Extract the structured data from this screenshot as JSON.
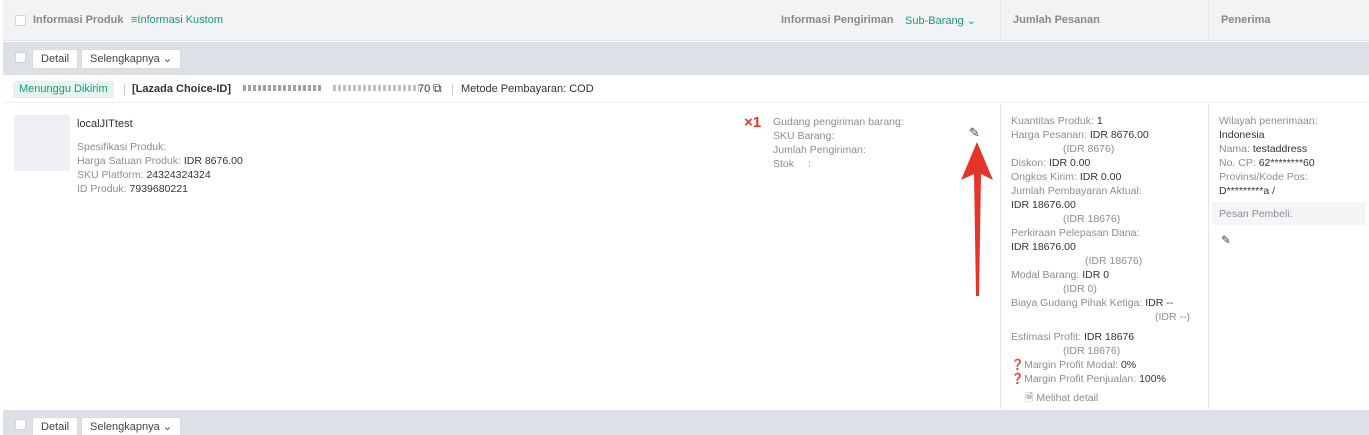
{
  "header": {
    "product_info": "Informasi Produk",
    "custom_info": "Informasi Kustom",
    "shipping_info": "Informasi Pengiriman",
    "sub_item": "Sub-Barang",
    "order_amount": "Jumlah Pesanan",
    "receiver": "Penerima"
  },
  "toolbar": {
    "detail": "Detail",
    "more": "Selengkapnya"
  },
  "order": {
    "status": "Menunggu Dikirim",
    "store": "[Lazada Choice-ID]",
    "order_number_visible": "70",
    "payment": "Metode Pembayaran: COD"
  },
  "product": {
    "name": "localJITtest",
    "spec_label": "Spesifikasi Produk:",
    "unit_price_label": "Harga Satuan Produk:",
    "unit_price": "IDR 8676.00",
    "sku_label": "SKU Platform:",
    "sku": "24324324324",
    "id_label": "ID Produk:",
    "id": "7939680221",
    "qty_badge": "×1"
  },
  "shipping": {
    "warehouse_label": "Gudang pengiriman barang:",
    "sku_label": "SKU Barang:",
    "qty_label": "Jumlah Pengiriman:",
    "stock_label": "Stok",
    "stock_colon": ":"
  },
  "amounts": {
    "qty_label": "Kuantitas Produk:",
    "qty": "1",
    "order_price_label": "Harga Pesanan:",
    "order_price": "IDR 8676.00",
    "order_price_idr": "(IDR 8676)",
    "discount_label": "Diskon:",
    "discount": "IDR 0.00",
    "shipping_label": "Ongkos Kirim:",
    "shipping": "IDR 0.00",
    "actual_pay_label": "Jumlah Pembayaran Aktual:",
    "actual_pay": "IDR 18676.00",
    "actual_pay_idr": "(IDR 18676)",
    "release_label": "Perkiraan Pelepasan Dana:",
    "release": "IDR 18676.00",
    "release_idr": "(IDR 18676)",
    "capital_label": "Modal Barang:",
    "capital": "IDR 0",
    "capital_idr": "(IDR 0)",
    "third_wh_label": "Biaya Gudang Pihak Ketiga:",
    "third_wh": "IDR --",
    "third_wh_idr": "(IDR --)",
    "profit_label": "Estimasi Profit:",
    "profit": "IDR 18676",
    "profit_idr": "(IDR 18676)",
    "margin_capital_label": "Margin Profit Modal:",
    "margin_capital": "0%",
    "margin_sales_label": "Margin Profit Penjualan:",
    "margin_sales": "100%",
    "see_detail": "Melihat detail"
  },
  "receiver": {
    "region_label": "Wilayah penerimaan:",
    "region": "Indonesia",
    "name_label": "Nama:",
    "name": "testaddress",
    "phone_label": "No. CP:",
    "phone": "62********60",
    "province_label": "Provinsi/Kode Pos:",
    "province": "D*********a /",
    "buyer_message_label": "Pesan Pembeli:"
  },
  "colors": {
    "accent": "#1c9a7a",
    "red": "#e5352b"
  }
}
